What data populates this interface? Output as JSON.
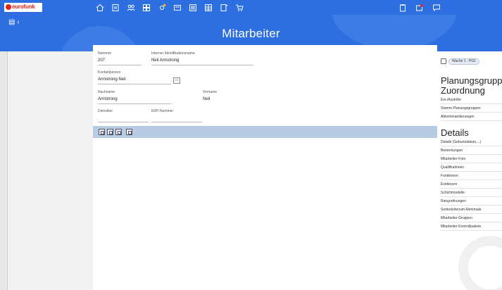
{
  "app": {
    "logo_text": "eurofunk",
    "title": "Mitarbeiter"
  },
  "toolbar": {
    "icons": [
      "home-icon",
      "document-icon",
      "users-icon",
      "grid-icon",
      "settings-icon",
      "form-icon",
      "list-icon",
      "table-icon",
      "sheet-icon",
      "cart-icon"
    ],
    "right_icons": [
      "clipboard-icon",
      "notification-icon",
      "chat-icon"
    ]
  },
  "sidebar_toggle": "▤ ‹",
  "form": {
    "nummer_label": "Nummer",
    "nummer_value": "207",
    "intern_label": "Interner Identifikationsname",
    "intern_value": "Neil Armstrong",
    "kontakt_label": "Kontaktperson",
    "kontakt_value": "Armstrong Neil",
    "nachname_label": "Nachname",
    "nachname_value": "Armstrong",
    "vorname_label": "Vorname",
    "vorname_value": "Neil",
    "dienst_label": "Dienstitel",
    "dienst_value": "",
    "erp_label": "ERP-Nummer",
    "erp_value": ""
  },
  "right_panel": {
    "chip_label": "Wache 1 - PG1",
    "section1_title_line1": "Planungsgruppe",
    "section1_title_line2": "Zuordnung",
    "section1_items": [
      "Ein-/Austritte",
      "Stamm-Planungsgruppen",
      "Abkommandierungen"
    ],
    "section2_title": "Details",
    "section2_items": [
      "Details (Geburtsdatum,...)",
      "Bemerkungen",
      "Mitarbeiter-Foto",
      "Qualifikationen",
      "Funktionen",
      "Evidenzen",
      "Schichtmodelle",
      "Rangordnungen",
      "Sortierkriterium-Merkmale",
      "Mitarbeiter-Gruppen",
      "Mitarbeiter-Kontrollpakete"
    ]
  },
  "colors": {
    "accent": "#2d6fe0",
    "list_toolbar": "#b7cce2",
    "logo_red": "#e2231a"
  }
}
